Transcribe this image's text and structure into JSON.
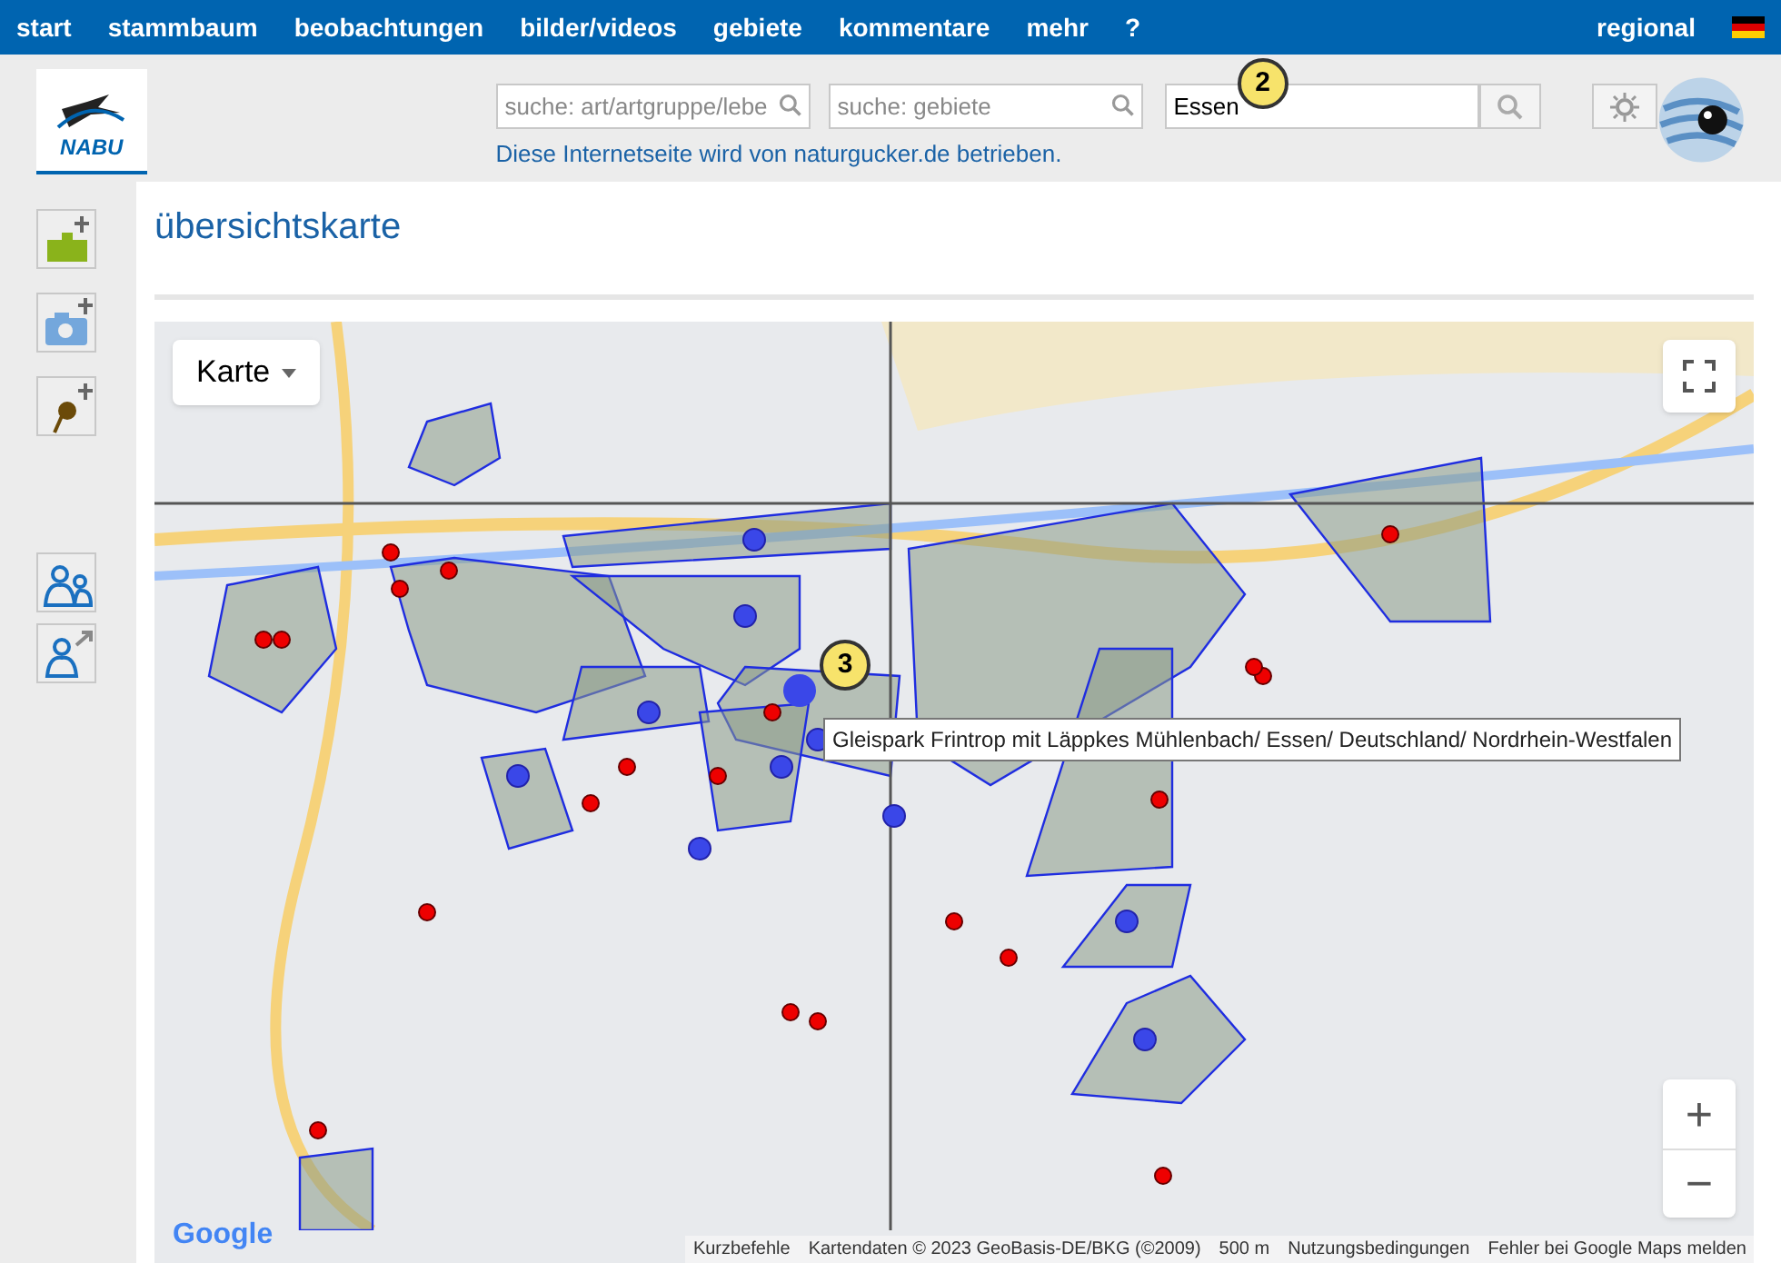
{
  "nav": {
    "items": [
      "start",
      "stammbaum",
      "beobachtungen",
      "bilder/videos",
      "gebiete",
      "kommentare",
      "mehr",
      "?"
    ],
    "right": "regional"
  },
  "header": {
    "search_fields": [
      {
        "placeholder": "suche: art/artgruppe/lebe"
      },
      {
        "placeholder": "suche: gebiete"
      },
      {
        "value": "Essen"
      }
    ],
    "notice": "Diese Internetseite wird von naturgucker.de betrieben.",
    "logo_text": "NABU"
  },
  "badges": [
    {
      "label": "2"
    },
    {
      "label": "3"
    }
  ],
  "page_title": "übersichtskarte",
  "map": {
    "type_button": "Karte",
    "tooltip": "Gleispark Frintrop mit Läppkes Mühlenbach/ Essen/ Deutschland/ Nordrhein-Westfalen",
    "zoom_in": "+",
    "zoom_out": "−",
    "google": "Google",
    "footer": [
      "Kurzbefehle",
      "Kartendaten © 2023 GeoBasis-DE/BKG (©2009)",
      "500 m",
      "Nutzungsbedingungen",
      "Fehler bei Google Maps melden"
    ]
  }
}
